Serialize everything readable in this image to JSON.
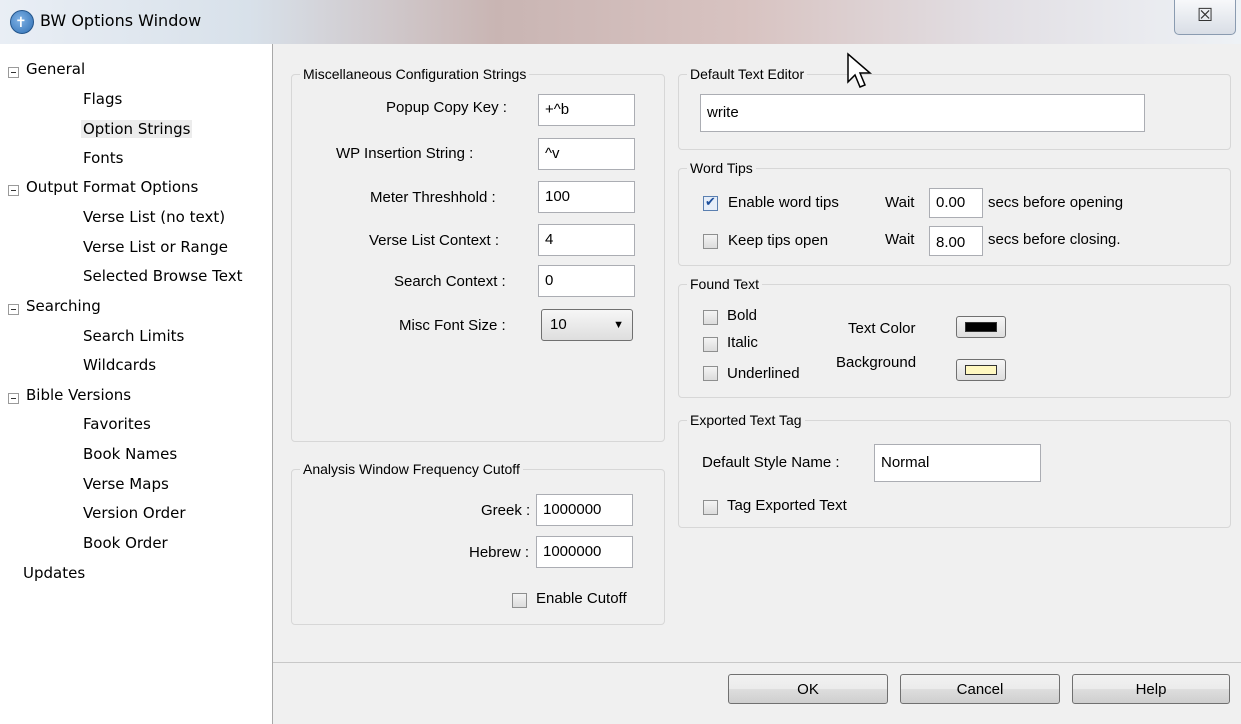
{
  "window": {
    "title": "BW Options Window",
    "close_glyph": "☒"
  },
  "icons": {
    "app": "bible-windows-app-icon",
    "close": "close-icon",
    "cursor": "mouse-cursor-icon"
  },
  "tree": {
    "general": {
      "label": "General",
      "children": [
        "Flags",
        "Option Strings",
        "Fonts"
      ]
    },
    "output": {
      "label": "Output Format Options",
      "children": [
        "Verse List (no text)",
        "Verse List or Range",
        "Selected Browse Text"
      ]
    },
    "searching": {
      "label": "Searching",
      "children": [
        "Search Limits",
        "Wildcards"
      ]
    },
    "bible": {
      "label": "Bible Versions",
      "children": [
        "Favorites",
        "Book Names",
        "Verse Maps",
        "Version Order",
        "Book Order"
      ]
    },
    "updates": {
      "label": "Updates"
    },
    "selected": "Option Strings"
  },
  "misc": {
    "title": "Miscellaneous Configuration Strings",
    "popup_copy_key": {
      "label": "Popup Copy Key :",
      "value": "+^b"
    },
    "wp_insertion": {
      "label": "WP Insertion String :",
      "value": "^v"
    },
    "meter": {
      "label": "Meter Threshhold :",
      "value": "100"
    },
    "verse_context": {
      "label": "Verse List Context :",
      "value": "4"
    },
    "search_context": {
      "label": "Search Context :",
      "value": "0"
    },
    "font_size": {
      "label": "Misc Font Size :",
      "value": "10"
    }
  },
  "analysis": {
    "title": "Analysis Window Frequency Cutoff",
    "greek": {
      "label": "Greek :",
      "value": "1000000"
    },
    "hebrew": {
      "label": "Hebrew :",
      "value": "1000000"
    },
    "enable_cutoff": {
      "label": "Enable Cutoff",
      "checked": false
    }
  },
  "editor": {
    "title": "Default Text Editor",
    "value": "write"
  },
  "word_tips": {
    "title": "Word Tips",
    "enable": {
      "label": "Enable word tips",
      "checked": true,
      "wait_label": "Wait",
      "wait_value": "0.00",
      "suffix": "secs before opening"
    },
    "keep": {
      "label": "Keep tips open",
      "checked": false,
      "wait_label": "Wait",
      "wait_value": "8.00",
      "suffix": "secs before closing."
    }
  },
  "found_text": {
    "title": "Found Text",
    "bold": {
      "label": "Bold",
      "checked": false
    },
    "italic": {
      "label": "Italic",
      "checked": false
    },
    "underlined": {
      "label": "Underlined",
      "checked": false
    },
    "text_color": {
      "label": "Text Color",
      "color": "#000000"
    },
    "background": {
      "label": "Background",
      "color": "#fff8c0"
    }
  },
  "exported": {
    "title": "Exported Text Tag",
    "style": {
      "label": "Default Style Name :",
      "value": "Normal"
    },
    "tag": {
      "label": "Tag Exported Text",
      "checked": false
    }
  },
  "buttons": {
    "ok": "OK",
    "cancel": "Cancel",
    "help": "Help"
  }
}
